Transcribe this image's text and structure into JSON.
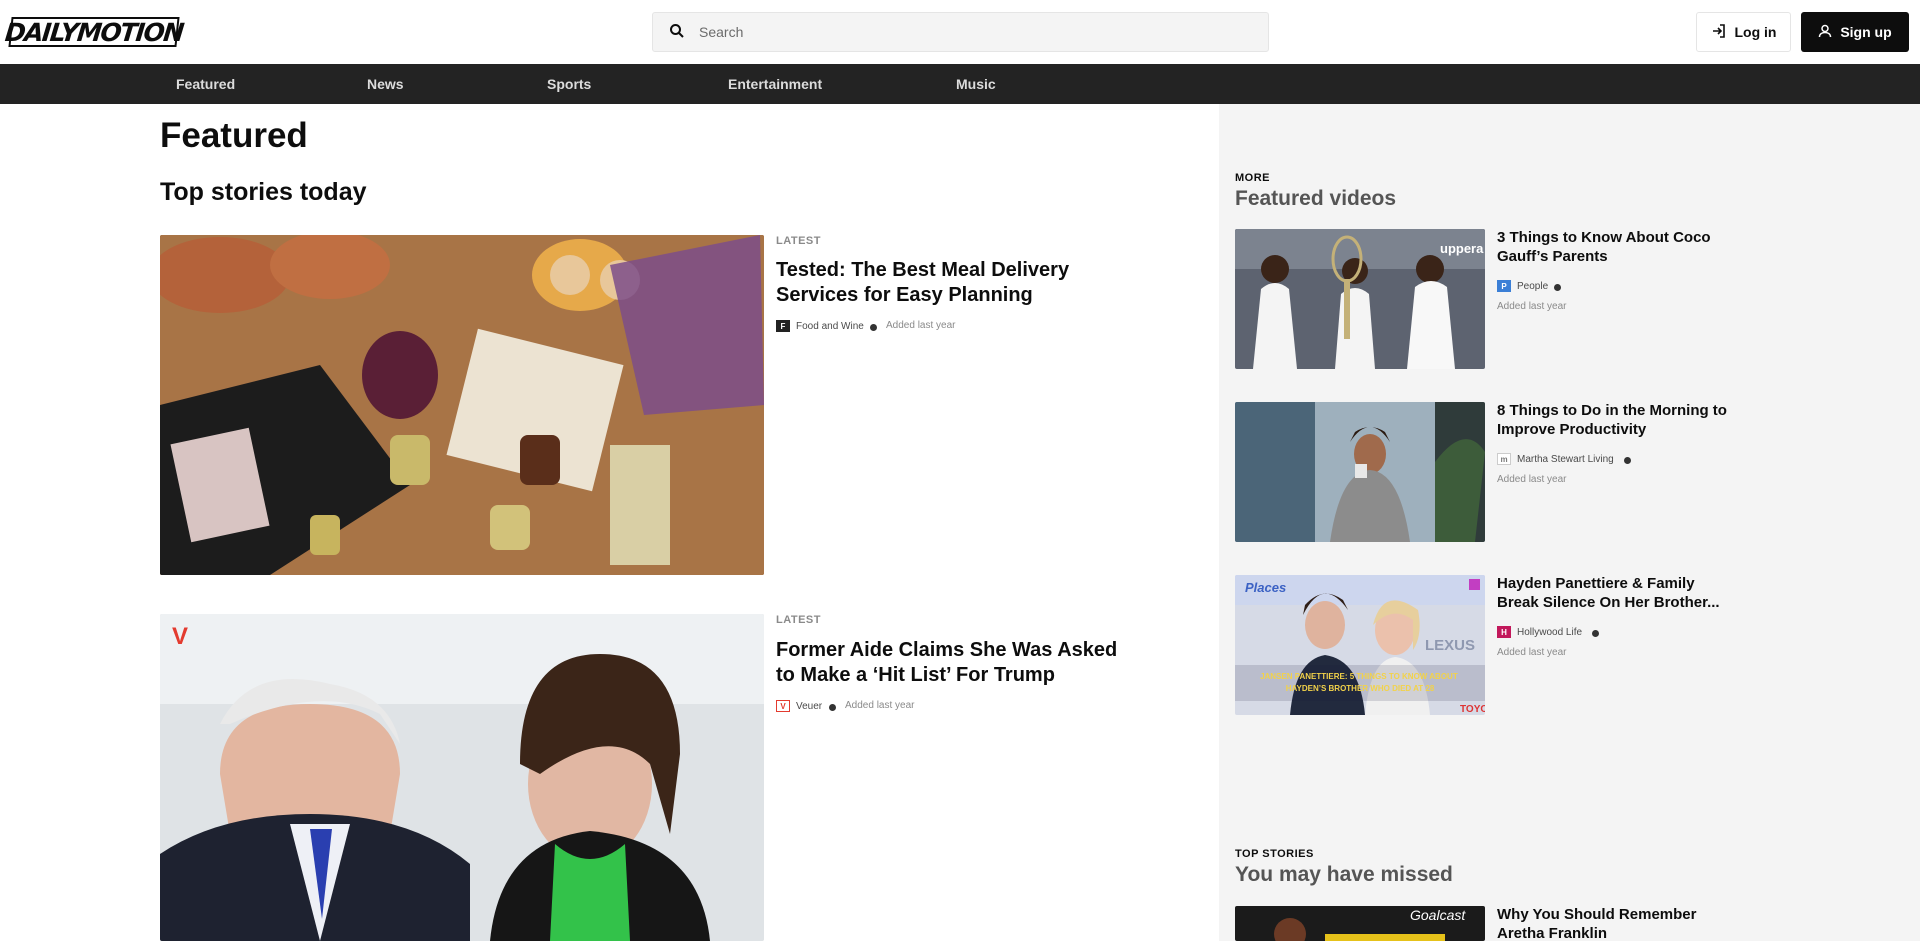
{
  "header": {
    "logo_text": "DAILYMOTION",
    "search_placeholder": "Search",
    "login_label": "Log in",
    "signup_label": "Sign up"
  },
  "nav": {
    "items": [
      {
        "label": "Featured"
      },
      {
        "label": "News"
      },
      {
        "label": "Sports"
      },
      {
        "label": "Entertainment"
      },
      {
        "label": "Music"
      }
    ]
  },
  "main": {
    "page_title": "Featured",
    "section_title": "Top stories today",
    "stories": [
      {
        "kicker": "LATEST",
        "title": "Tested: The Best Meal Delivery Services for Easy Planning",
        "channel": "Food and Wine",
        "added": "Added last year"
      },
      {
        "kicker": "LATEST",
        "title": "Former Aide Claims She Was Asked to Make a ‘Hit List’ For Trump",
        "channel": "Veuer",
        "added": "Added last year"
      }
    ]
  },
  "sidebar": {
    "featured_kicker": "MORE",
    "featured_heading": "Featured videos",
    "featured_videos": [
      {
        "title": "3 Things to Know About Coco Gauff’s Parents",
        "channel": "People",
        "added": "Added last year"
      },
      {
        "title": "8 Things to Do in the Morning to Improve Productivity",
        "channel": "Martha Stewart Living",
        "added": "Added last year"
      },
      {
        "title": "Hayden Panettiere & Family Break Silence On Her Brother...",
        "channel": "Hollywood Life",
        "added": "Added last year",
        "thumb_text": "JANSEN PANETTIERE: 5 THINGS TO KNOW ABOUT HAYDEN’S BROTHER WHO DIED AT 28",
        "thumb_places": "Places"
      }
    ],
    "missed_kicker": "TOP STORIES",
    "missed_heading": "You may have missed",
    "missed_videos": [
      {
        "title": "Why You Should Remember Aretha Franklin",
        "thumb_brand": "Goalcast"
      }
    ]
  }
}
